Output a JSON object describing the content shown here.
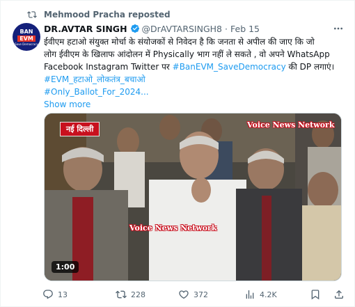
{
  "repost": {
    "text": "Mehmood Pracha reposted",
    "icon": "repost-icon"
  },
  "author": {
    "name": "DR.AVTAR SINGH",
    "handle": "@DrAVTARSINGH8",
    "separator": "·",
    "date": "Feb 15",
    "avatar": {
      "line1": "BAN",
      "line2": "EVM",
      "line3": "Save Democracy"
    }
  },
  "tweet": {
    "line1": "ईवीएम हटाओ संयुक्त मोर्चा के संयोजकों से निवेदन है कि जनता से अपील की जाए कि जो",
    "line2": "लोग ईवीएम के खिलाफ आंदोलन में Physically भाग नहीं ले सकते , वो अपने WhatsApp",
    "line3_plain": "Facebook Instagram Twitter पर ",
    "line3_tag": "#BanEVM_SaveDemocracy",
    "line3_end": " की DP लगाएं।",
    "hashtag2": "#EVM_हटाओ_लोकतंत्र_बचाओ",
    "hashtag3": "#Only_Ballot_For_2024...",
    "show_more": "Show more"
  },
  "media": {
    "city_tag": "नई दिल्ली",
    "watermark_top": "Voice News Network",
    "watermark_mid": "Voice News Network",
    "duration": "1:00"
  },
  "actions": {
    "replies": "13",
    "reposts": "228",
    "likes": "372",
    "views": "4.2K"
  },
  "colors": {
    "link": "#1d9bf0",
    "muted": "#536471",
    "text": "#0f1419",
    "verified": "#1d9bf0",
    "city_tag_bg": "#c8101e"
  }
}
